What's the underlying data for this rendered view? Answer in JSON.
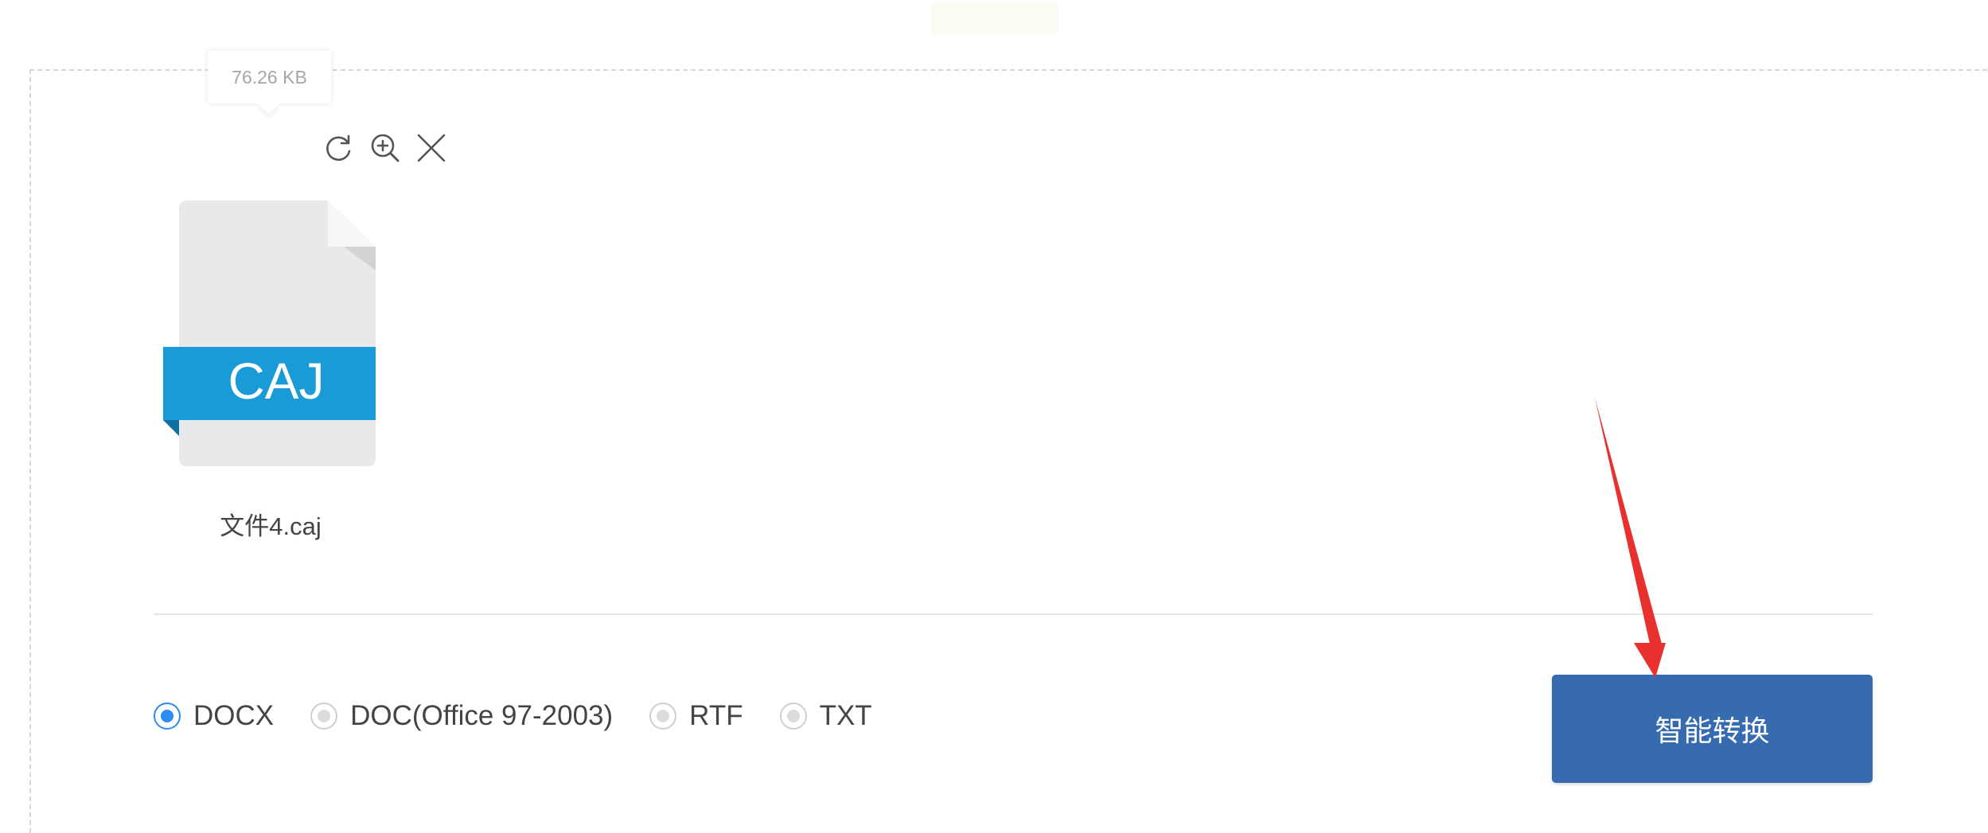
{
  "file": {
    "size": "76.26 KB",
    "icon_label": "CAJ",
    "name": "文件4.caj",
    "icon_color": "#1a9bd7"
  },
  "file_actions": [
    {
      "icon": "refresh-icon"
    },
    {
      "icon": "zoom-in-icon"
    },
    {
      "icon": "close-icon"
    }
  ],
  "formats": {
    "selected": "DOCX",
    "options": [
      "DOCX",
      "DOC(Office 97-2003)",
      "RTF",
      "TXT"
    ]
  },
  "convert_button": {
    "label": "智能转换",
    "color": "#376bb0"
  },
  "annotation": {
    "arrow_color": "#e8312f"
  },
  "accent_color": "#2d8cf0"
}
